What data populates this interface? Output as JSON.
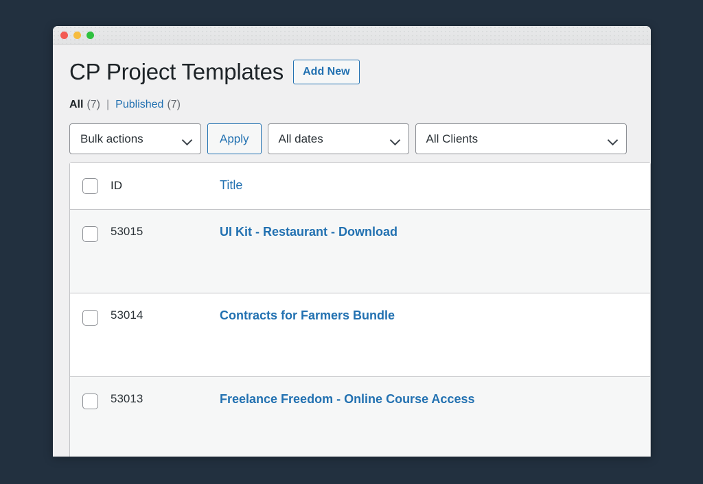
{
  "window": {
    "traffic_lights": [
      "close",
      "minimize",
      "zoom"
    ]
  },
  "header": {
    "title": "CP Project Templates",
    "add_new_label": "Add New"
  },
  "status_links": {
    "all_label": "All",
    "all_count": "(7)",
    "separator": "|",
    "published_label": "Published",
    "published_count": "(7)"
  },
  "filters": {
    "bulk_actions_value": "Bulk actions",
    "apply_label": "Apply",
    "dates_value": "All dates",
    "clients_value": "All Clients"
  },
  "table": {
    "columns": {
      "id": "ID",
      "title": "Title"
    },
    "rows": [
      {
        "id": "53015",
        "title": "UI Kit - Restaurant - Download"
      },
      {
        "id": "53014",
        "title": "Contracts for Farmers Bundle"
      },
      {
        "id": "53013",
        "title": "Freelance Freedom - Online Course Access"
      }
    ]
  },
  "colors": {
    "desktop_background": "#22303f",
    "link_blue": "#2271b1",
    "page_background": "#f0f0f1",
    "row_alt_background": "#f6f7f7",
    "text_dark": "#1d2327"
  }
}
